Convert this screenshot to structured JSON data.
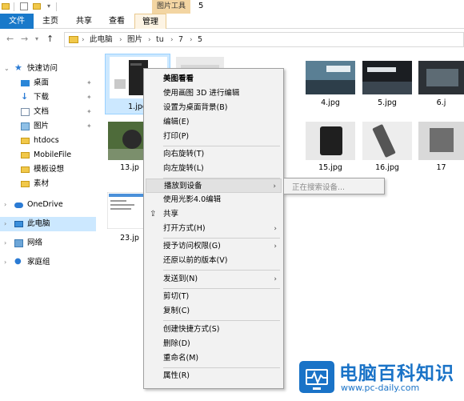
{
  "title_bar": {
    "contextual_tab_header": "图片工具",
    "window_title": "5"
  },
  "ribbon": {
    "tabs": [
      "文件",
      "主页",
      "共享",
      "查看",
      "管理"
    ]
  },
  "address": {
    "breadcrumbs": [
      "此电脑",
      "图片",
      "tu",
      "7",
      "5"
    ]
  },
  "nav": {
    "quick_access": "快速访问",
    "items": [
      {
        "label": "桌面",
        "icon": "desktop-icon",
        "pinned": true
      },
      {
        "label": "下载",
        "icon": "download-icon",
        "pinned": true
      },
      {
        "label": "文档",
        "icon": "document-icon",
        "pinned": true
      },
      {
        "label": "图片",
        "icon": "pictures-icon",
        "pinned": true
      },
      {
        "label": "htdocs",
        "icon": "folder-icon",
        "pinned": false
      },
      {
        "label": "MobileFile",
        "icon": "folder-icon",
        "pinned": false
      },
      {
        "label": "模板设想",
        "icon": "folder-icon",
        "pinned": false
      },
      {
        "label": "素材",
        "icon": "folder-icon",
        "pinned": false
      }
    ],
    "onedrive": "OneDrive",
    "this_pc": "此电脑",
    "network": "网络",
    "homegroup": "家庭组"
  },
  "files": [
    {
      "name": "1.jpg",
      "selected": true
    },
    {
      "name": "4.jpg",
      "selected": false
    },
    {
      "name": "5.jpg",
      "selected": false
    },
    {
      "name": "6.j",
      "selected": false
    },
    {
      "name": "13.jp",
      "selected": false
    },
    {
      "name": "15.jpg",
      "selected": false
    },
    {
      "name": "16.jpg",
      "selected": false
    },
    {
      "name": "17",
      "selected": false
    },
    {
      "name": "23.jp",
      "selected": false
    }
  ],
  "context_menu": {
    "items": [
      "美图看看",
      "使用画图 3D 进行编辑",
      "设置为桌面背景(B)",
      "编辑(E)",
      "打印(P)",
      "向右旋转(T)",
      "向左旋转(L)",
      "播放到设备",
      "使用光影4.0编辑",
      "共享",
      "打开方式(H)",
      "授予访问权限(G)",
      "还原以前的版本(V)",
      "发送到(N)",
      "剪切(T)",
      "复制(C)",
      "创建快捷方式(S)",
      "删除(D)",
      "重命名(M)",
      "属性(R)"
    ]
  },
  "submenu": {
    "status": "正在搜索设备..."
  },
  "watermark": {
    "title": "电脑百科知识",
    "url": "www.pc-daily.com"
  },
  "colors": {
    "file_tab": "#1979ca",
    "selection": "#cce8ff",
    "contextual_tab": "#f3d5a2",
    "menu_bg": "#f2f2f2",
    "watermark": "#1a73c7"
  }
}
